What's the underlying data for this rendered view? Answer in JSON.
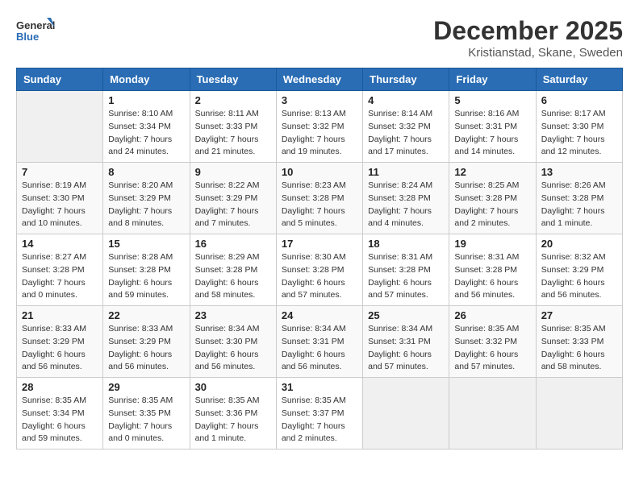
{
  "logo": {
    "line1": "General",
    "line2": "Blue"
  },
  "title": "December 2025",
  "subtitle": "Kristianstad, Skane, Sweden",
  "weekdays": [
    "Sunday",
    "Monday",
    "Tuesday",
    "Wednesday",
    "Thursday",
    "Friday",
    "Saturday"
  ],
  "weeks": [
    [
      {
        "day": "",
        "info": ""
      },
      {
        "day": "1",
        "info": "Sunrise: 8:10 AM\nSunset: 3:34 PM\nDaylight: 7 hours\nand 24 minutes."
      },
      {
        "day": "2",
        "info": "Sunrise: 8:11 AM\nSunset: 3:33 PM\nDaylight: 7 hours\nand 21 minutes."
      },
      {
        "day": "3",
        "info": "Sunrise: 8:13 AM\nSunset: 3:32 PM\nDaylight: 7 hours\nand 19 minutes."
      },
      {
        "day": "4",
        "info": "Sunrise: 8:14 AM\nSunset: 3:32 PM\nDaylight: 7 hours\nand 17 minutes."
      },
      {
        "day": "5",
        "info": "Sunrise: 8:16 AM\nSunset: 3:31 PM\nDaylight: 7 hours\nand 14 minutes."
      },
      {
        "day": "6",
        "info": "Sunrise: 8:17 AM\nSunset: 3:30 PM\nDaylight: 7 hours\nand 12 minutes."
      }
    ],
    [
      {
        "day": "7",
        "info": "Sunrise: 8:19 AM\nSunset: 3:30 PM\nDaylight: 7 hours\nand 10 minutes."
      },
      {
        "day": "8",
        "info": "Sunrise: 8:20 AM\nSunset: 3:29 PM\nDaylight: 7 hours\nand 8 minutes."
      },
      {
        "day": "9",
        "info": "Sunrise: 8:22 AM\nSunset: 3:29 PM\nDaylight: 7 hours\nand 7 minutes."
      },
      {
        "day": "10",
        "info": "Sunrise: 8:23 AM\nSunset: 3:28 PM\nDaylight: 7 hours\nand 5 minutes."
      },
      {
        "day": "11",
        "info": "Sunrise: 8:24 AM\nSunset: 3:28 PM\nDaylight: 7 hours\nand 4 minutes."
      },
      {
        "day": "12",
        "info": "Sunrise: 8:25 AM\nSunset: 3:28 PM\nDaylight: 7 hours\nand 2 minutes."
      },
      {
        "day": "13",
        "info": "Sunrise: 8:26 AM\nSunset: 3:28 PM\nDaylight: 7 hours\nand 1 minute."
      }
    ],
    [
      {
        "day": "14",
        "info": "Sunrise: 8:27 AM\nSunset: 3:28 PM\nDaylight: 7 hours\nand 0 minutes."
      },
      {
        "day": "15",
        "info": "Sunrise: 8:28 AM\nSunset: 3:28 PM\nDaylight: 6 hours\nand 59 minutes."
      },
      {
        "day": "16",
        "info": "Sunrise: 8:29 AM\nSunset: 3:28 PM\nDaylight: 6 hours\nand 58 minutes."
      },
      {
        "day": "17",
        "info": "Sunrise: 8:30 AM\nSunset: 3:28 PM\nDaylight: 6 hours\nand 57 minutes."
      },
      {
        "day": "18",
        "info": "Sunrise: 8:31 AM\nSunset: 3:28 PM\nDaylight: 6 hours\nand 57 minutes."
      },
      {
        "day": "19",
        "info": "Sunrise: 8:31 AM\nSunset: 3:28 PM\nDaylight: 6 hours\nand 56 minutes."
      },
      {
        "day": "20",
        "info": "Sunrise: 8:32 AM\nSunset: 3:29 PM\nDaylight: 6 hours\nand 56 minutes."
      }
    ],
    [
      {
        "day": "21",
        "info": "Sunrise: 8:33 AM\nSunset: 3:29 PM\nDaylight: 6 hours\nand 56 minutes."
      },
      {
        "day": "22",
        "info": "Sunrise: 8:33 AM\nSunset: 3:29 PM\nDaylight: 6 hours\nand 56 minutes."
      },
      {
        "day": "23",
        "info": "Sunrise: 8:34 AM\nSunset: 3:30 PM\nDaylight: 6 hours\nand 56 minutes."
      },
      {
        "day": "24",
        "info": "Sunrise: 8:34 AM\nSunset: 3:31 PM\nDaylight: 6 hours\nand 56 minutes."
      },
      {
        "day": "25",
        "info": "Sunrise: 8:34 AM\nSunset: 3:31 PM\nDaylight: 6 hours\nand 57 minutes."
      },
      {
        "day": "26",
        "info": "Sunrise: 8:35 AM\nSunset: 3:32 PM\nDaylight: 6 hours\nand 57 minutes."
      },
      {
        "day": "27",
        "info": "Sunrise: 8:35 AM\nSunset: 3:33 PM\nDaylight: 6 hours\nand 58 minutes."
      }
    ],
    [
      {
        "day": "28",
        "info": "Sunrise: 8:35 AM\nSunset: 3:34 PM\nDaylight: 6 hours\nand 59 minutes."
      },
      {
        "day": "29",
        "info": "Sunrise: 8:35 AM\nSunset: 3:35 PM\nDaylight: 7 hours\nand 0 minutes."
      },
      {
        "day": "30",
        "info": "Sunrise: 8:35 AM\nSunset: 3:36 PM\nDaylight: 7 hours\nand 1 minute."
      },
      {
        "day": "31",
        "info": "Sunrise: 8:35 AM\nSunset: 3:37 PM\nDaylight: 7 hours\nand 2 minutes."
      },
      {
        "day": "",
        "info": ""
      },
      {
        "day": "",
        "info": ""
      },
      {
        "day": "",
        "info": ""
      }
    ]
  ]
}
